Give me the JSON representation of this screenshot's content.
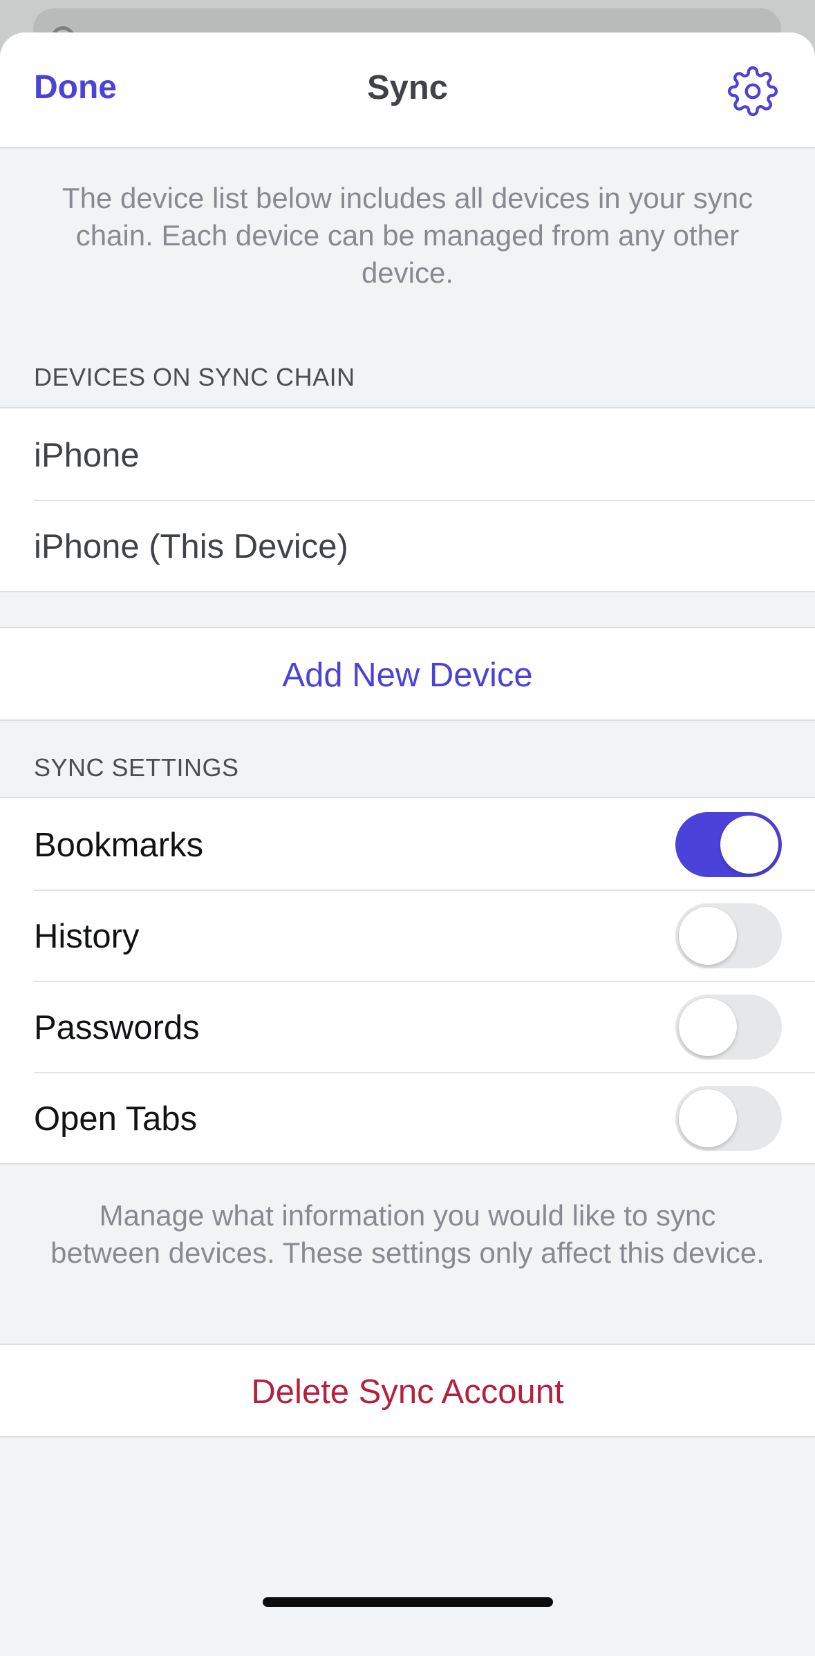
{
  "navbar": {
    "done_label": "Done",
    "title": "Sync",
    "settings_icon": "gear-icon"
  },
  "intro": {
    "text": "The device list below includes all devices in your sync chain. Each device can be managed from any other device."
  },
  "devices_section": {
    "header": "DEVICES ON SYNC CHAIN",
    "devices": [
      {
        "label": "iPhone"
      },
      {
        "label": "iPhone (This Device)"
      }
    ]
  },
  "add_device": {
    "label": "Add New Device"
  },
  "sync_settings": {
    "header": "SYNC SETTINGS",
    "items": [
      {
        "label": "Bookmarks",
        "enabled": true
      },
      {
        "label": "History",
        "enabled": false
      },
      {
        "label": "Passwords",
        "enabled": false
      },
      {
        "label": "Open Tabs",
        "enabled": false
      }
    ],
    "footer": "Manage what information you would like to sync between devices. These settings only affect this device."
  },
  "delete_account": {
    "label": "Delete Sync Account"
  },
  "colors": {
    "accent": "#4a42d9",
    "destructive": "#b5203f",
    "toggle_off": "#e6e7e9"
  }
}
